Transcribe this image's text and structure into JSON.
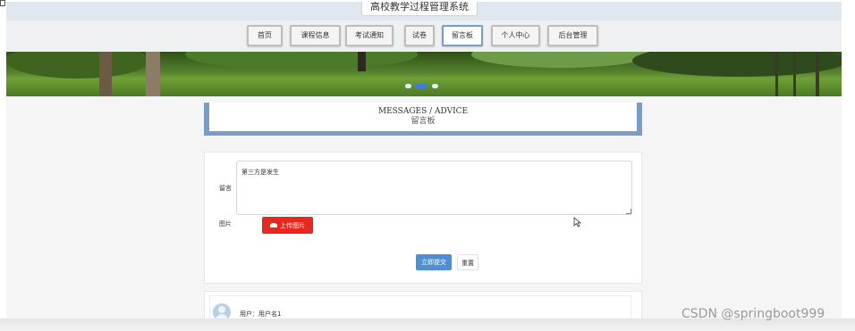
{
  "site": {
    "title": "高校教学过程管理系统"
  },
  "nav": {
    "items": [
      {
        "label": "首页"
      },
      {
        "label": "课程信息"
      },
      {
        "label": "考试通知"
      },
      {
        "label": "试卷"
      },
      {
        "label": "留言板",
        "active": true
      },
      {
        "label": "个人中心"
      },
      {
        "label": "后台管理"
      }
    ]
  },
  "banner": {
    "slides": 3,
    "active_slide": 2
  },
  "section": {
    "title_en": "MESSAGES / ADVICE",
    "title_cn": "留言板"
  },
  "form": {
    "message_label": "留言",
    "message_value": "第三方是发生",
    "image_label": "图片",
    "upload_label": "上传图片",
    "submit_label": "立即提交",
    "reset_label": "重置"
  },
  "comments": [
    {
      "user": "用户：用户名1"
    }
  ],
  "watermark": "CSDN @springboot999",
  "colors": {
    "accent": "#7a9cc6",
    "upload": "#e5291e",
    "submit": "#4f8fd1"
  }
}
